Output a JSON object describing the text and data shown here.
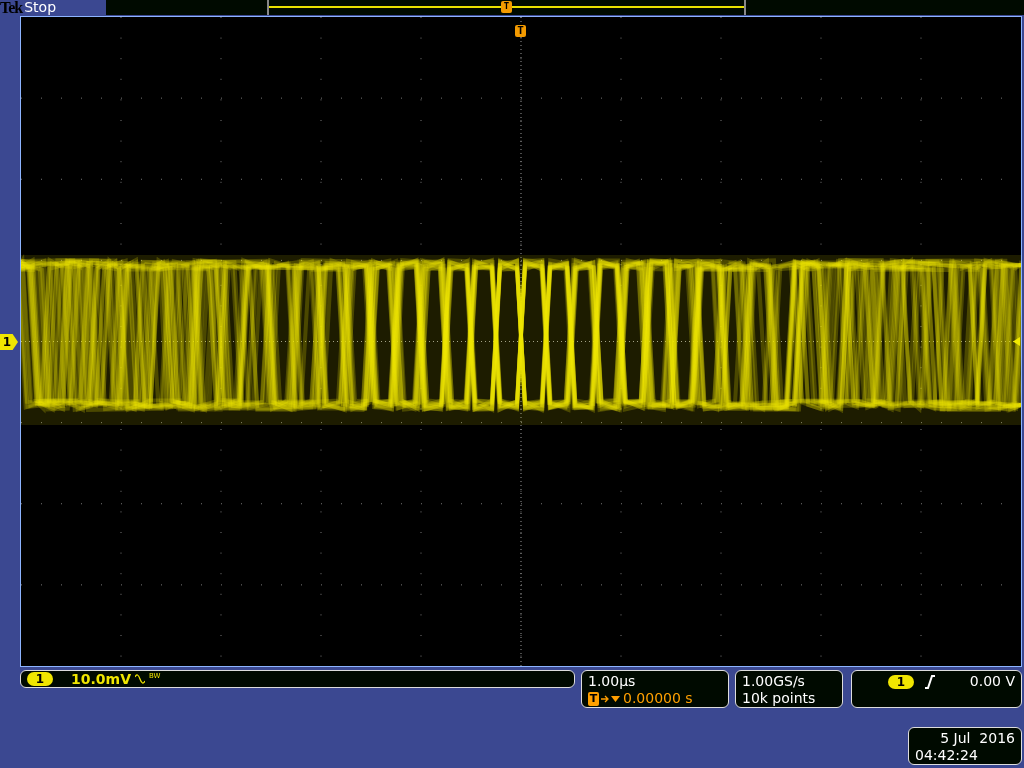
{
  "status_bar": {
    "brand": "Tek",
    "state": "Stop"
  },
  "record_view": {
    "trigger_marker": "T"
  },
  "screen": {
    "trigger_marker": "T",
    "channel_marker": "1"
  },
  "channel_readout": {
    "channel": "1",
    "scale": "10.0mV",
    "bandwidth_label": "BW"
  },
  "timebase": {
    "scale": "1.00µs",
    "trigger_badge": "T",
    "position": "0.00000 s"
  },
  "acquisition": {
    "sample_rate": "1.00GS/s",
    "record_length": "10k points"
  },
  "trigger": {
    "channel": "1",
    "kind": "rising",
    "trigger_level": "0.00 V"
  },
  "datetime": {
    "date": "5 Jul  2016",
    "time": "04:42:24"
  }
}
